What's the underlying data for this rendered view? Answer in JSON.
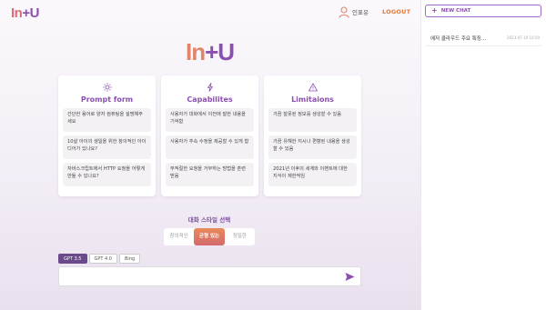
{
  "header": {
    "logo_a": "In",
    "logo_b": "+U",
    "user_name": "인표유",
    "logout_label": "LOGOUT"
  },
  "sidebar": {
    "new_chat_label": "NEW CHAT",
    "chats": [
      {
        "title": "에저 클라우드 주요 특징...",
        "date": "2023-07-19 10:59"
      }
    ]
  },
  "main": {
    "logo_a": "In",
    "logo_b": "+U",
    "cards": [
      {
        "icon": "sun-icon",
        "title": "Prompt form",
        "items": [
          "간단한 용어로 양자 컴퓨팅을 설명해주세요",
          "10살 아이의 생일을 위한 창의적인 아이디어가 있나요?",
          "자바스크립트에서 HTTP 요청을 어떻게 만들 수 있나요?"
        ]
      },
      {
        "icon": "lightning-icon",
        "title": "Capabilites",
        "items": [
          "사용자가 대화에서 이전에 말한 내용을 기억함",
          "사용자가 추속 수정을 제공할 수 있게 함",
          "부적절한 요청을 거부하는 방법을 훈련받음"
        ]
      },
      {
        "icon": "warning-icon",
        "title": "Limitaions",
        "items": [
          "가끔 잘못된 정보를 생성할 수 있음",
          "가끔 유해한 지시나 편향된 내용을 생성할 수 있음",
          "2021년 이후의 세계와 이벤트에 대한 지식이 제한적임"
        ]
      }
    ],
    "style_title": "대화 스타일 선택",
    "style_options": [
      "창의적인",
      "균형 있는",
      "정밀한"
    ],
    "style_selected": "균형 있는",
    "model_tabs": [
      "GPT 3.5",
      "GPT 4.0",
      "Bing"
    ],
    "model_selected": "GPT 3.5",
    "input_value": "",
    "input_placeholder": ""
  },
  "colors": {
    "accent_purple": "#8a4fb0",
    "accent_orange": "#e07a3a"
  }
}
